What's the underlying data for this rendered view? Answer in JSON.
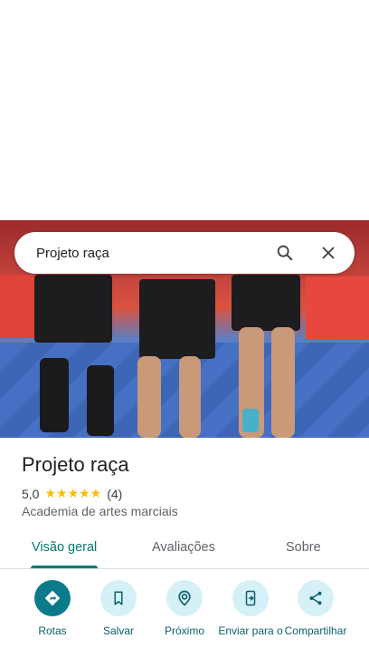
{
  "search": {
    "query": "Projeto raça"
  },
  "place": {
    "name": "Projeto raça",
    "rating": "5,0",
    "stars": "★★★★★",
    "review_count": "(4)",
    "category": "Academia de artes marciais"
  },
  "tabs": [
    {
      "label": "Visão geral",
      "active": true
    },
    {
      "label": "Avaliações",
      "active": false
    },
    {
      "label": "Sobre",
      "active": false
    }
  ],
  "actions": [
    {
      "label": "Rotas",
      "icon": "directions-icon"
    },
    {
      "label": "Salvar",
      "icon": "bookmark-icon"
    },
    {
      "label": "Próximo",
      "icon": "nearby-icon"
    },
    {
      "label": "Enviar para o",
      "icon": "send-to-phone-icon"
    },
    {
      "label": "Compartilhar",
      "icon": "share-icon"
    }
  ],
  "colors": {
    "accent": "#00796b",
    "action_bg": "#d5f0f7",
    "primary_action": "#0b7a8b",
    "stars": "#fbbc04"
  }
}
